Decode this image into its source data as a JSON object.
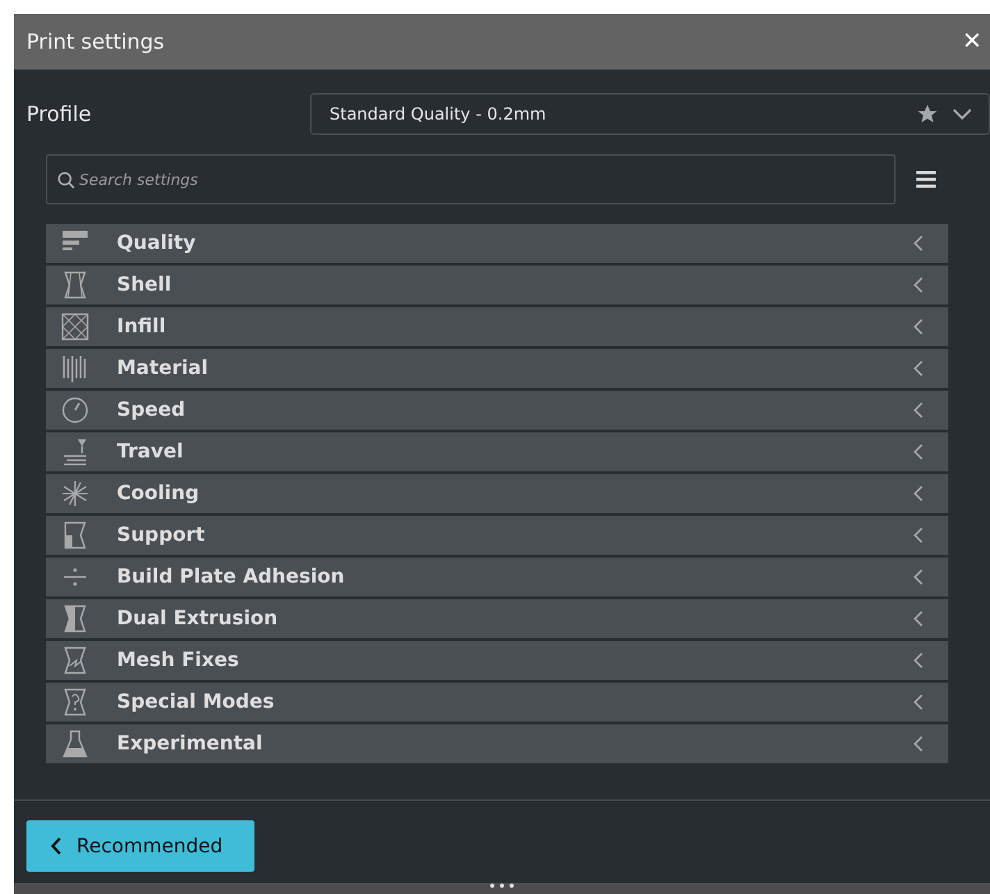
{
  "window": {
    "title": "Print settings",
    "close": "✕"
  },
  "profile": {
    "label": "Profile",
    "value": "Standard Quality - 0.2mm"
  },
  "search": {
    "placeholder": "Search settings"
  },
  "categories": [
    {
      "label": "Quality",
      "kind": "quality",
      "expanded": false
    },
    {
      "label": "Shell",
      "kind": "shell",
      "expanded": false
    },
    {
      "label": "Infill",
      "kind": "infill",
      "expanded": false
    },
    {
      "label": "Material",
      "kind": "material",
      "expanded": false
    },
    {
      "label": "Speed",
      "kind": "speed",
      "expanded": false
    },
    {
      "label": "Travel",
      "kind": "travel",
      "expanded": false
    },
    {
      "label": "Cooling",
      "kind": "cooling",
      "expanded": false
    },
    {
      "label": "Support",
      "kind": "support",
      "expanded": false
    },
    {
      "label": "Build Plate Adhesion",
      "kind": "adhesion",
      "expanded": false
    },
    {
      "label": "Dual Extrusion",
      "kind": "dual",
      "expanded": false
    },
    {
      "label": "Mesh Fixes",
      "kind": "mesh",
      "expanded": false
    },
    {
      "label": "Special Modes",
      "kind": "special",
      "expanded": false
    },
    {
      "label": "Experimental",
      "kind": "experimental",
      "expanded": false
    }
  ],
  "footer": {
    "button": "Recommended"
  }
}
